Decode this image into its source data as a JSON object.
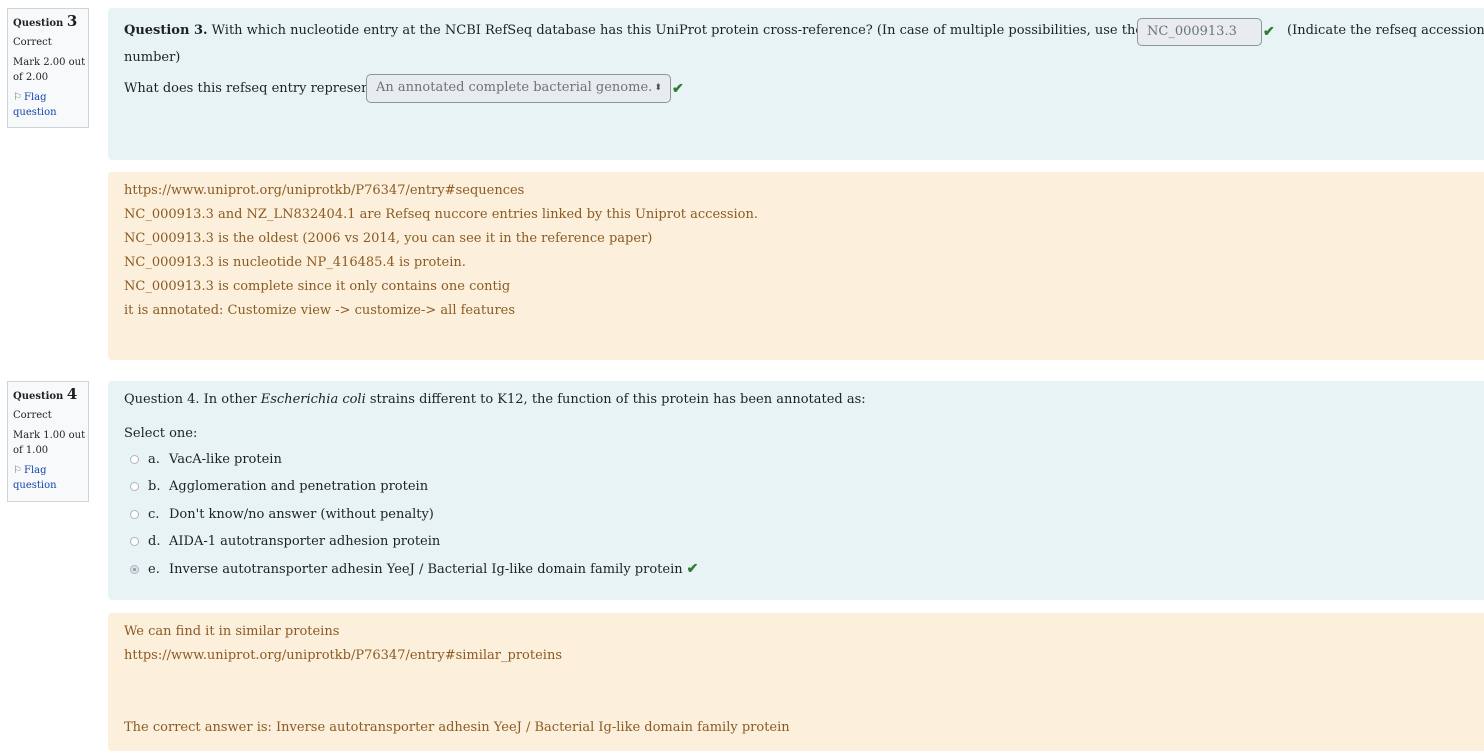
{
  "q3": {
    "info": {
      "title_word": "Question",
      "number": "3",
      "state": "Correct",
      "grade_line1": "Mark 2.00 out",
      "grade_line2": "of 2.00",
      "flag_line1": "Flag",
      "flag_line2": "question"
    },
    "prefix": "Question 3.",
    "text": " With which nucleotide entry at the NCBI RefSeq database has this UniProt protein cross-reference? (In case of multiple possibilities, use the oldest one)",
    "answer_value": "NC_000913.3",
    "after_input": "(Indicate the refseq accession",
    "after_input_wrap": "number)",
    "sub_question": "What does this refseq entry represent?",
    "select_value": "An annotated complete bacterial genome.",
    "feedback": [
      "https://www.uniprot.org/uniprotkb/P76347/entry#sequences",
      "NC_000913.3 and NZ_LN832404.1 are Refseq nuccore entries linked by this Uniprot accession.",
      "NC_000913.3 is the oldest (2006 vs 2014, you can see it in the reference paper)",
      "NC_000913.3 is nucleotide NP_416485.4 is protein.",
      "NC_000913.3 is complete since it only contains one contig",
      "it is annotated: Customize view -> customize-> all features"
    ]
  },
  "q4": {
    "info": {
      "title_word": "Question",
      "number": "4",
      "state": "Correct",
      "grade_line1": "Mark 1.00 out",
      "grade_line2": "of 1.00",
      "flag_line1": "Flag",
      "flag_line2": "question"
    },
    "text_before": "Question 4. In other ",
    "text_italic": "Escherichia coli",
    "text_after": " strains different to K12, the function of this protein has been annotated as:",
    "prompt": "Select one:",
    "options": [
      {
        "letter": "a.",
        "label": "VacA-like protein",
        "checked": false
      },
      {
        "letter": "b.",
        "label": "Agglomeration and penetration protein",
        "checked": false
      },
      {
        "letter": "c.",
        "label": "Don't know/no answer (without penalty)",
        "checked": false
      },
      {
        "letter": "d.",
        "label": "AIDA-1 autotransporter adhesion protein",
        "checked": false
      },
      {
        "letter": "e.",
        "label": "Inverse autotransporter adhesin YeeJ / Bacterial Ig-like domain family protein",
        "checked": true
      }
    ],
    "feedback": [
      "We can find it in similar proteins",
      "https://www.uniprot.org/uniprotkb/P76347/entry#similar_proteins"
    ],
    "right_answer": "The correct answer is: Inverse autotransporter adhesin YeeJ / Bacterial Ig-like domain family protein"
  },
  "colors": {
    "formulation_bg": "#e7f3f5",
    "feedback_bg": "#fcefdc",
    "feedback_text": "#8a5b22",
    "correct_check": "#2e7d32",
    "link": "#0f47ad"
  },
  "icons": [
    "flag-icon",
    "check-icon",
    "select-arrows-icon"
  ]
}
